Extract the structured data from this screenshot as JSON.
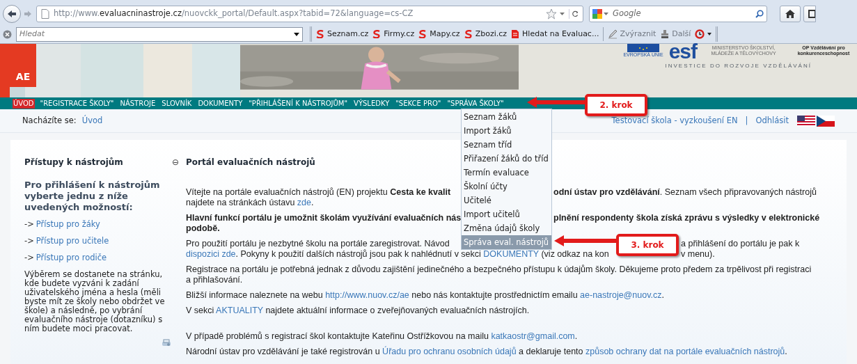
{
  "browser": {
    "url_host": "http://www.",
    "url_domain": "evaluacninastroje.cz",
    "url_path": "/nuovckk_portal/Default.aspx?tabid=72&language=cs-CZ",
    "search_placeholder": "Google",
    "find_placeholder": "Hledat",
    "bookmarks": [
      {
        "label": "Seznam.cz",
        "color": "#e3201b"
      },
      {
        "label": "Firmy.cz",
        "color": "#e3201b"
      },
      {
        "label": "Mapy.cz",
        "color": "#e3201b"
      },
      {
        "label": "Zbozi.cz",
        "color": "#e3201b"
      },
      {
        "label": "Hledat na Evaluac...",
        "color": "#e3201b"
      }
    ],
    "tools": [
      {
        "label": "Zvýraznit"
      },
      {
        "label": "Další"
      }
    ]
  },
  "banner": {
    "logo": "AE",
    "eu_label": "EVROPSKÁ UNIE",
    "esf": "esf",
    "ministry": "MINISTERSTVO ŠKOLSTVÍ, MLÁDEŽE A TĚLOVÝCHOVY",
    "op": "OP Vzdělávání pro konkurenceschopnost",
    "slogan": "INVESTICE DO ROZVOJE VZDĚLÁVÁNÍ"
  },
  "nav": [
    {
      "label": "ÚVOD",
      "selected": true
    },
    {
      "label": "\"REGISTRACE ŠKOLY\"",
      "selected": false
    },
    {
      "label": "NÁSTROJE",
      "selected": false
    },
    {
      "label": "SLOVNÍK",
      "selected": false
    },
    {
      "label": "DOKUMENTY",
      "selected": false
    },
    {
      "label": "\"PŘIHLÁŠENÍ K NÁSTROJŮM\"",
      "selected": false
    },
    {
      "label": "VÝSLEDKY",
      "selected": false
    },
    {
      "label": "\"SEKCE PRO\"",
      "selected": false
    },
    {
      "label": "\"SPRÁVA ŠKOLY\"",
      "selected": false
    }
  ],
  "dropdown": [
    {
      "label": "Seznam žáků",
      "selected": false
    },
    {
      "label": "Import žáků",
      "selected": false
    },
    {
      "label": "Seznam tříd",
      "selected": false
    },
    {
      "label": "Přiřazení žáků do tříd",
      "selected": false
    },
    {
      "label": "Termín evaluace",
      "selected": false
    },
    {
      "label": "Školní účty",
      "selected": false
    },
    {
      "label": "Učitelé",
      "selected": false
    },
    {
      "label": "Import učitelů",
      "selected": false
    },
    {
      "label": "Změna údajů školy",
      "selected": false
    },
    {
      "label": "Správa eval. nástrojů",
      "selected": true
    }
  ],
  "callouts": [
    {
      "text": "2. krok"
    },
    {
      "text": "3. krok"
    }
  ],
  "breadcrumb": {
    "label": "Nacházíte se:",
    "link": "Úvod"
  },
  "user": {
    "school": "Testovací škola - vyzkoušení EN",
    "separator": "|",
    "logout": "Odhlásit"
  },
  "sidebar": {
    "title": "Přístupy k nástrojům",
    "collapse": "⊖",
    "heading": "Pro přihlášení k nástrojům vyberte jednu z níže uvedených možností:",
    "links": [
      {
        "arrow": "->",
        "label": "Přístup pro žáky"
      },
      {
        "arrow": "->",
        "label": "Přístup pro učitele"
      },
      {
        "arrow": "->",
        "label": "Přístup pro rodiče"
      }
    ],
    "note": "Výběrem se dostanete na stránku, kde budete vyzváni k zadání uživatelského jména a hesla (měli byste mít ze školy nebo obdržet ve škole) a následně, po vybrání evaluačního nástroje (dotazníku) s ním budete moci pracovat."
  },
  "main": {
    "title": "Portál evaluačních nástrojů",
    "paragraphs": [
      {
        "lines": [
          {
            "parts": [
              [
                {
                  "kind": "text",
                  "text": "Vítejte na portále evaluačních nástrojů (EN) projektu "
                },
                {
                  "kind": "bold",
                  "text": "Cesta ke kvalit"
                }
              ],
              [
                {
                  "kind": "bold",
                  "text": "odní ústav pro vzdělávání"
                },
                {
                  "kind": "text",
                  "text": ". Seznam všech připravovaných nástrojů"
                }
              ]
            ]
          },
          {
            "parts": [
              [
                {
                  "kind": "text",
                  "text": "najdete na stránkách ústavu "
                },
                {
                  "kind": "link",
                  "text": "zde"
                },
                {
                  "kind": "text",
                  "text": "."
                }
              ]
            ]
          }
        ]
      },
      {
        "lines": [
          {
            "parts": [
              [
                {
                  "kind": "bold",
                  "text": "Hlavní funkcí portálu je umožnit školám využívání evaluačních nás"
                }
              ],
              [
                {
                  "kind": "bold",
                  "text": "plnění respondenty škola získá zprávu s výsledky v elektronické"
                }
              ]
            ]
          },
          {
            "parts": [
              [
                {
                  "kind": "bold",
                  "text": "podobě."
                }
              ]
            ]
          }
        ]
      },
      {
        "lines": [
          {
            "parts": [
              [
                {
                  "kind": "text",
                  "text": "Pro použití portálu je nezbytné školu na portále zaregistrovat. Návod"
                }
              ],
              [
                {
                  "kind": "text",
                  "text": "a přihlášení do portálu je pak k"
                }
              ]
            ]
          },
          {
            "parts": [
              [
                {
                  "kind": "link",
                  "text": "dispozici zde"
                },
                {
                  "kind": "text",
                  "text": ". Pokyny k použití dalších nástrojů jsou pak k nahlédnutí v sekci "
                },
                {
                  "kind": "link",
                  "text": "DOKUMENTY"
                },
                {
                  "kind": "text",
                  "text": " (viz odkaz na kon"
                }
              ],
              [
                {
                  "kind": "text",
                  "text": "v menu)."
                }
              ]
            ]
          }
        ]
      },
      {
        "segments": [
          {
            "kind": "text",
            "text": "Registrace na portálu je potřebná jednak z důvodu zajištění jedinečného a bezpečného přístupu k údajům školy. Děkujeme proto předem za trpělivost při registraci a přihlašování."
          }
        ]
      },
      {
        "segments": [
          {
            "kind": "text",
            "text": "Bližší informace naleznete na webu "
          },
          {
            "kind": "link",
            "text": "http://www.nuov.cz/ae"
          },
          {
            "kind": "text",
            "text": " nebo nás kontaktujte prostřednictím emailu "
          },
          {
            "kind": "link",
            "text": "ae-nastroje@nuov.cz"
          },
          {
            "kind": "text",
            "text": "."
          }
        ]
      },
      {
        "segments": [
          {
            "kind": "text",
            "text": "V sekci "
          },
          {
            "kind": "link",
            "text": "AKTUALITY"
          },
          {
            "kind": "text",
            "text": " najdete aktuální informace o zveřejňovaných evaluačních nástrojích."
          }
        ]
      },
      {
        "segments": [
          {
            "kind": "text",
            "text": "V případě problémů s registrací škol kontaktujte Kateřinu Ostřížkovou na mailu "
          },
          {
            "kind": "link",
            "text": "katkaostr@gmail.com"
          },
          {
            "kind": "text",
            "text": "."
          }
        ]
      },
      {
        "segments": [
          {
            "kind": "text",
            "text": "Národní ústav pro vzdělávání je také registrován u "
          },
          {
            "kind": "link",
            "text": "Úřadu pro ochranu osobních údajů"
          },
          {
            "kind": "text",
            "text": " a deklaruje tento "
          },
          {
            "kind": "link",
            "text": "způsob ochrany dat na portále evaluačních nástrojů"
          },
          {
            "kind": "text",
            "text": "."
          }
        ]
      }
    ]
  }
}
